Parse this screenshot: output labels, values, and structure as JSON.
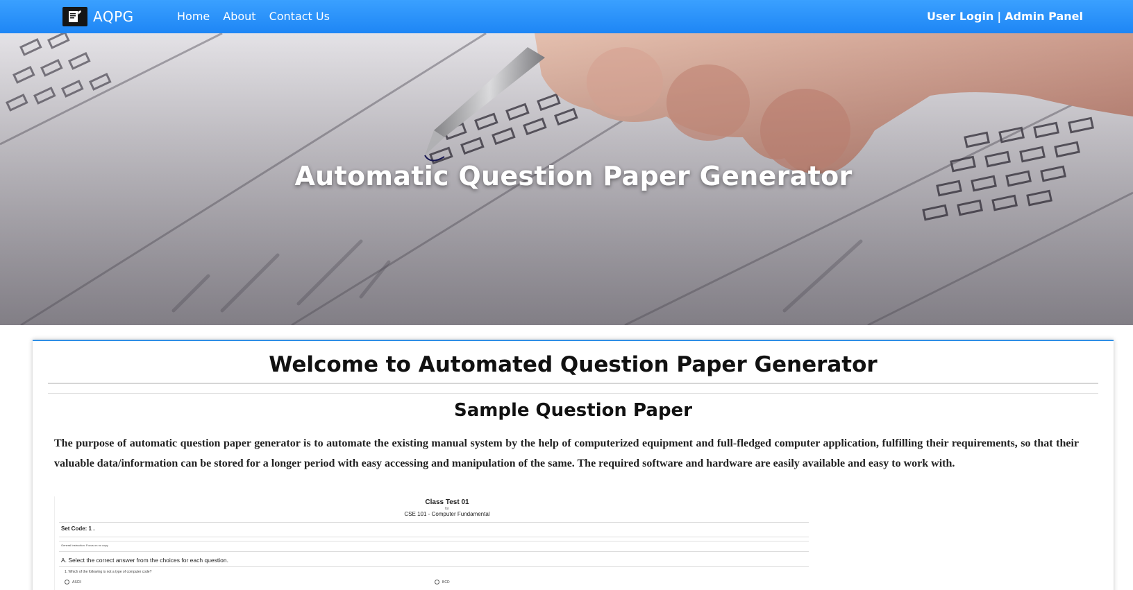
{
  "navbar": {
    "brand": "AQPG",
    "links": [
      "Home",
      "About",
      "Contact Us"
    ],
    "user_login": "User Login",
    "separator": "|",
    "admin_panel": "Admin Panel",
    "background_color": "#2a93fb"
  },
  "hero": {
    "title": "Automatic Question Paper Generator"
  },
  "main": {
    "welcome_heading": "Welcome to Automated Question Paper Generator",
    "sample_heading": "Sample Question Paper",
    "description": "The purpose of automatic question paper generator is to automate the existing manual system by the help of computerized equipment and full-fledged computer application, fulfilling their requirements, so that their valuable data/information can be stored for a longer period with easy accessing and manipulation of the same. The required software and hardware are easily available and easy to work with."
  },
  "sample_paper": {
    "title": "Class Test 01",
    "for_label": "for",
    "course": "CSE 101 - Computer Fundamental",
    "set_code": "Set Code: 1 .",
    "general_instruction": "General Instruction: Focus on no copy",
    "section_a": "A. Select the correct answer from the choices for each question.",
    "question_1": "1.    Which of the following is not a type of computer code?",
    "options": [
      "ASCII",
      "BCD"
    ]
  }
}
